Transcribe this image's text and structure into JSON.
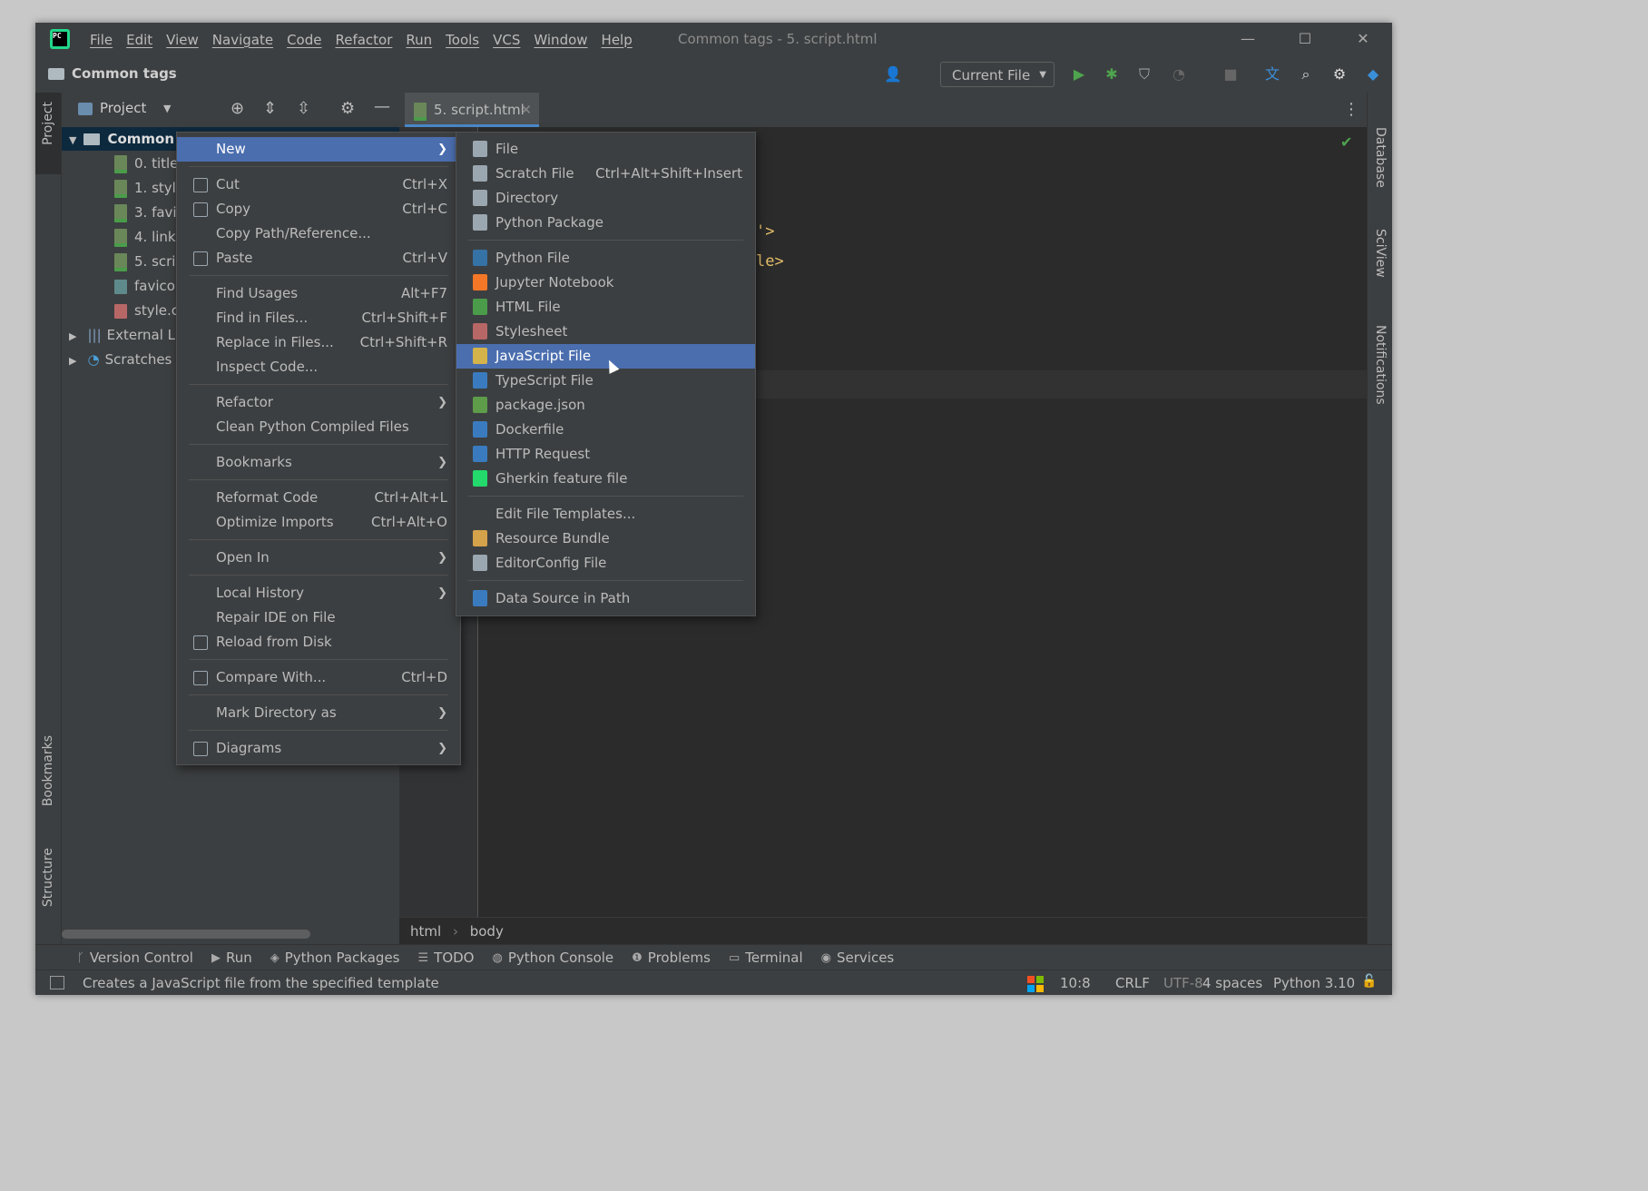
{
  "window": {
    "title": "Common tags - 5. script.html",
    "menu": [
      "File",
      "Edit",
      "View",
      "Navigate",
      "Code",
      "Refactor",
      "Run",
      "Tools",
      "VCS",
      "Window",
      "Help"
    ]
  },
  "navbar": {
    "project_crumb": "Common tags",
    "run_config": "Current File"
  },
  "left_stripe": {
    "project": "Project",
    "bookmarks": "Bookmarks",
    "structure": "Structure"
  },
  "right_stripe": {
    "database": "Database",
    "sciview": "SciView",
    "notifications": "Notifications"
  },
  "project_panel": {
    "title": "Project",
    "tree": {
      "root": "Common",
      "files": [
        "0. title",
        "1. styl",
        "3. favi",
        "4. link",
        "5. scri",
        "favico",
        "style.c"
      ],
      "external": "External L",
      "scratches": "Scratches"
    }
  },
  "editor": {
    "tab": "5. script.html",
    "code_fragments": [
      "'>",
      "le>"
    ],
    "breadcrumbs": [
      "html",
      "body"
    ]
  },
  "context_menu": {
    "items": [
      {
        "label": "New",
        "shortcut": "",
        "submenu": true,
        "selected": true
      },
      {
        "sep": true
      },
      {
        "label": "Cut",
        "shortcut": "Ctrl+X",
        "icon": "scissors-icon"
      },
      {
        "label": "Copy",
        "shortcut": "Ctrl+C",
        "icon": "copy-icon"
      },
      {
        "label": "Copy Path/Reference...",
        "shortcut": ""
      },
      {
        "label": "Paste",
        "shortcut": "Ctrl+V",
        "icon": "clipboard-icon"
      },
      {
        "sep": true
      },
      {
        "label": "Find Usages",
        "shortcut": "Alt+F7"
      },
      {
        "label": "Find in Files...",
        "shortcut": "Ctrl+Shift+F"
      },
      {
        "label": "Replace in Files...",
        "shortcut": "Ctrl+Shift+R"
      },
      {
        "label": "Inspect Code...",
        "shortcut": ""
      },
      {
        "sep": true
      },
      {
        "label": "Refactor",
        "submenu": true
      },
      {
        "label": "Clean Python Compiled Files",
        "shortcut": ""
      },
      {
        "sep": true
      },
      {
        "label": "Bookmarks",
        "submenu": true
      },
      {
        "sep": true
      },
      {
        "label": "Reformat Code",
        "shortcut": "Ctrl+Alt+L"
      },
      {
        "label": "Optimize Imports",
        "shortcut": "Ctrl+Alt+O"
      },
      {
        "sep": true
      },
      {
        "label": "Open In",
        "submenu": true
      },
      {
        "sep": true
      },
      {
        "label": "Local History",
        "submenu": true
      },
      {
        "label": "Repair IDE on File",
        "shortcut": ""
      },
      {
        "label": "Reload from Disk",
        "shortcut": "",
        "icon": "reload-icon"
      },
      {
        "sep": true
      },
      {
        "label": "Compare With...",
        "shortcut": "Ctrl+D",
        "icon": "compare-icon"
      },
      {
        "sep": true
      },
      {
        "label": "Mark Directory as",
        "submenu": true
      },
      {
        "sep": true
      },
      {
        "label": "Diagrams",
        "submenu": true,
        "icon": "diagram-icon"
      }
    ]
  },
  "new_submenu": {
    "items": [
      {
        "label": "File",
        "shortcut": "",
        "icon": "file-icon",
        "color": "#9aa7b0"
      },
      {
        "label": "Scratch File",
        "shortcut": "Ctrl+Alt+Shift+Insert",
        "icon": "scratch-file-icon",
        "color": "#9aa7b0"
      },
      {
        "label": "Directory",
        "shortcut": "",
        "icon": "folder-icon",
        "color": "#9aa7b0"
      },
      {
        "label": "Python Package",
        "shortcut": "",
        "icon": "package-icon",
        "color": "#9aa7b0"
      },
      {
        "sep": true
      },
      {
        "label": "Python File",
        "icon": "python-file-icon",
        "color": "#3572a5"
      },
      {
        "label": "Jupyter Notebook",
        "icon": "jupyter-icon",
        "color": "#f37726"
      },
      {
        "label": "HTML File",
        "icon": "html-file-icon",
        "color": "#4a9c4a"
      },
      {
        "label": "Stylesheet",
        "icon": "css-file-icon",
        "color": "#b86767"
      },
      {
        "label": "JavaScript File",
        "icon": "js-file-icon",
        "color": "#d4b34a",
        "selected": true
      },
      {
        "label": "TypeScript File",
        "icon": "ts-file-icon",
        "color": "#3a7bbf"
      },
      {
        "label": "package.json",
        "icon": "nodejs-icon",
        "color": "#5e9c4a"
      },
      {
        "label": "Dockerfile",
        "icon": "docker-icon",
        "color": "#3a7bbf"
      },
      {
        "label": "HTTP Request",
        "icon": "api-icon",
        "color": "#3a7bbf"
      },
      {
        "label": "Gherkin feature file",
        "icon": "cucumber-icon",
        "color": "#23d96c"
      },
      {
        "sep": true
      },
      {
        "label": "Edit File Templates...",
        "icon": ""
      },
      {
        "label": "Resource Bundle",
        "icon": "resource-bundle-icon",
        "color": "#d4a24a"
      },
      {
        "label": "EditorConfig File",
        "icon": "gear-icon",
        "color": "#9aa7b0"
      },
      {
        "sep": true
      },
      {
        "label": "Data Source in Path",
        "icon": "database-icon",
        "color": "#3a7bbf"
      }
    ]
  },
  "tool_windows": [
    "Version Control",
    "Run",
    "Python Packages",
    "TODO",
    "Python Console",
    "Problems",
    "Terminal",
    "Services"
  ],
  "status": {
    "message": "Creates a JavaScript file from the specified template",
    "position": "10:8",
    "line_sep": "CRLF",
    "encoding": "UTF-8",
    "indent": "4 spaces",
    "interpreter": "Python 3.10"
  },
  "colors": {
    "accent": "#4b6eaf",
    "run": "#4ea44e",
    "background": "#2b2b2b",
    "panel": "#3c3f41"
  }
}
